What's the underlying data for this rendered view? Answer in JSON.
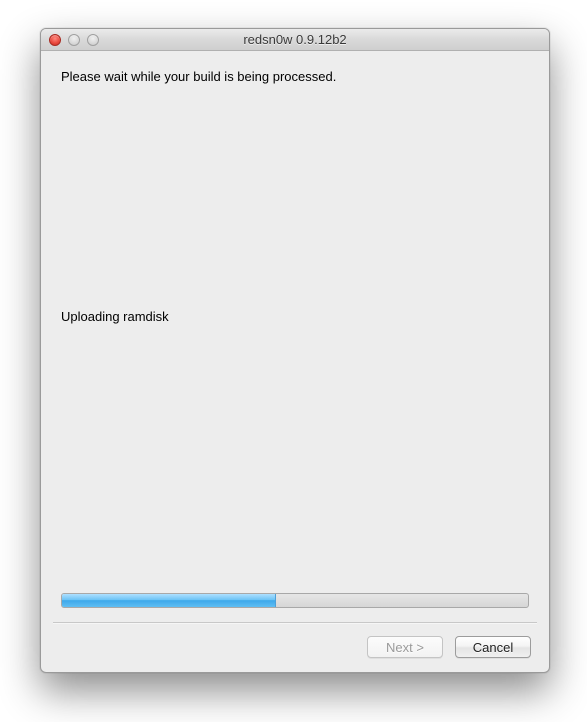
{
  "window": {
    "title": "redsn0w 0.9.12b2"
  },
  "content": {
    "instruction": "Please wait while your build is being processed.",
    "status": "Uploading ramdisk"
  },
  "progress": {
    "percent": 46
  },
  "buttons": {
    "next": "Next >",
    "cancel": "Cancel"
  }
}
